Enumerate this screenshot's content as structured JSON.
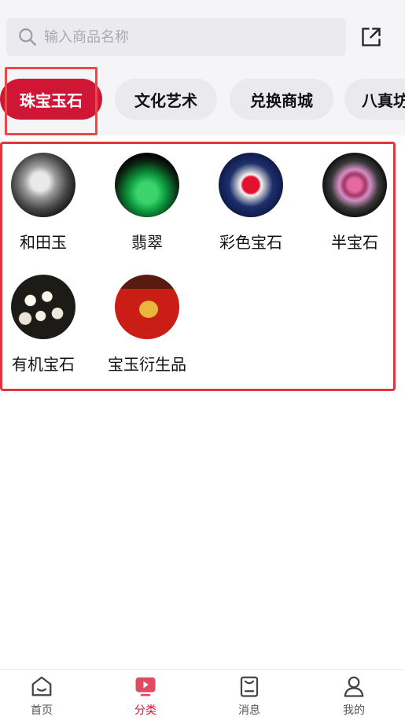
{
  "search": {
    "placeholder": "输入商品名称"
  },
  "tabs": [
    "珠宝玉石",
    "文化艺术",
    "兑换商城",
    "八真坊"
  ],
  "categories": [
    "和田玉",
    "翡翠",
    "彩色宝石",
    "半宝石",
    "有机宝石",
    "宝玉衍生品"
  ],
  "nav": [
    "首页",
    "分类",
    "消息",
    "我的"
  ],
  "colors": {
    "accent": "#cf1735",
    "highlight_box": "#e0353d",
    "tab_bg": "#e9e9ee",
    "page_top_bg": "#f5f5f7"
  }
}
